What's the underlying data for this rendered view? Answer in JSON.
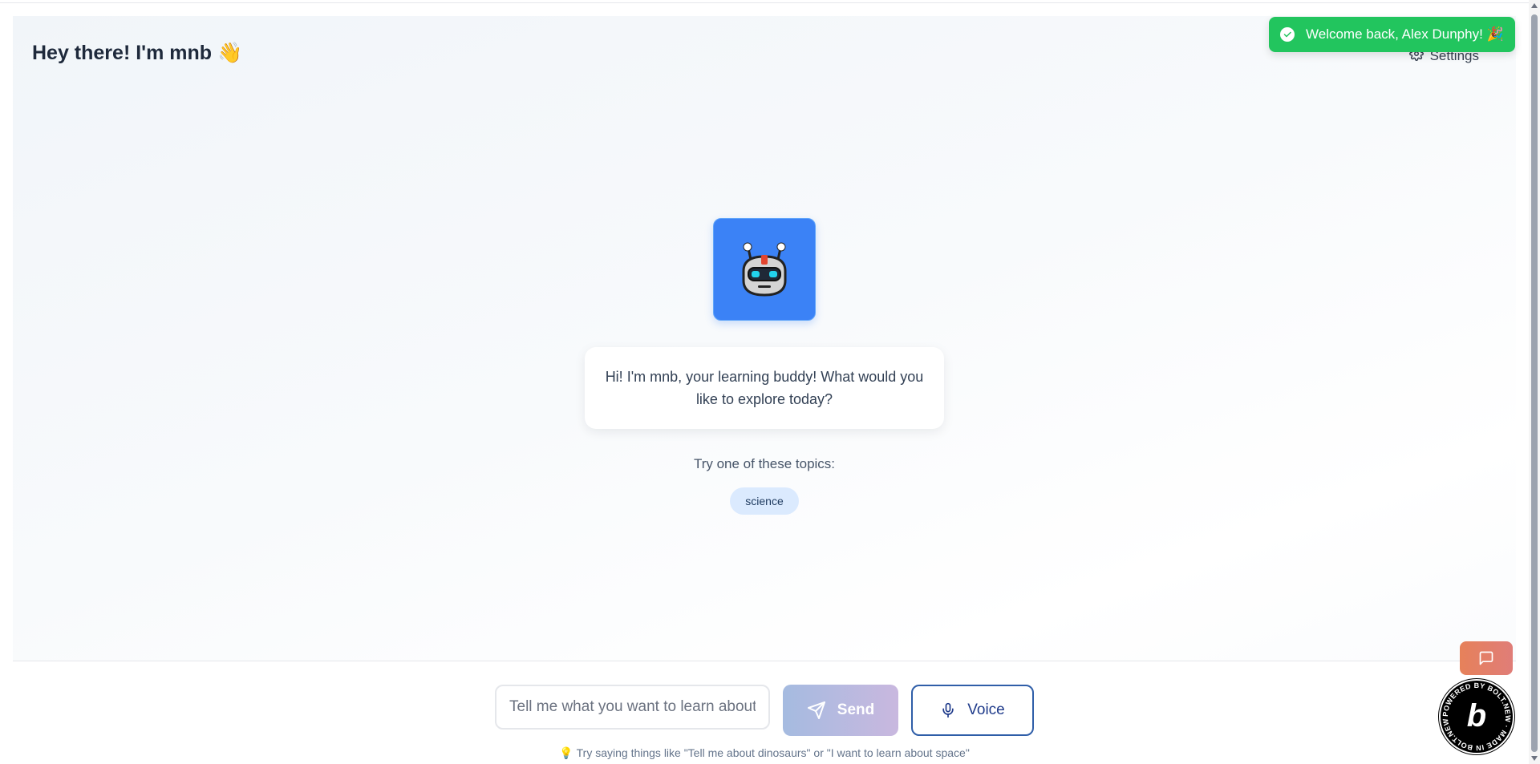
{
  "header": {
    "title": "Hey there! I'm mnb 👋",
    "settings_label": "Settings"
  },
  "assistant": {
    "avatar_icon": "robot-icon",
    "greeting": "Hi! I'm mnb, your learning buddy! What would you like to explore today?"
  },
  "topics": {
    "label": "Try one of these topics:",
    "items": [
      "science"
    ]
  },
  "composer": {
    "placeholder": "Tell me what you want to learn about",
    "send_label": "Send",
    "voice_label": "Voice",
    "tip": "Try saying things like \"Tell me about dinosaurs\" or \"I want to learn about space\""
  },
  "toast": {
    "message": "Welcome back, Alex Dunphy! 🎉"
  },
  "badge": {
    "text": "POWERED BY BOLT.NEW · MADE IN BOLT.NEW ·",
    "letter": "b"
  },
  "colors": {
    "primary": "#3b82f6",
    "toast_bg": "#22c55e",
    "chip_bg": "#dbeafe",
    "voice_border": "#2f5ea8"
  }
}
